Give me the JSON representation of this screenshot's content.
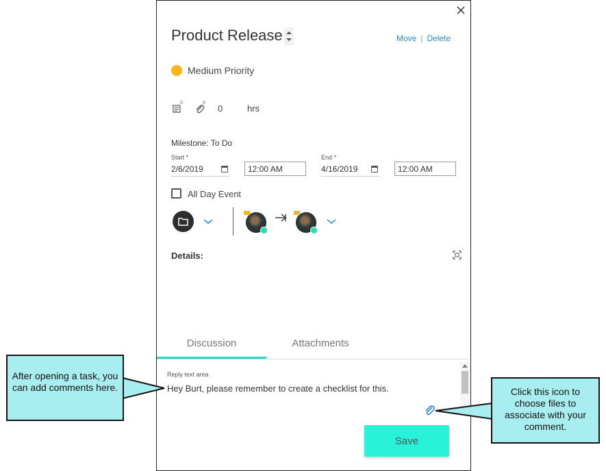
{
  "task": {
    "title": "Product Release",
    "links": {
      "move": "Move",
      "separator": "|",
      "delete": "Delete"
    },
    "priority": {
      "label": "Medium Priority",
      "color": "#fbb41c"
    },
    "stats": {
      "notes_count": "0",
      "attachments_count": "0",
      "hours_value": "0",
      "hours_unit": "hrs"
    },
    "milestone": "Milestone: To Do",
    "start": {
      "label": "Start *",
      "date": "2/6/2019",
      "time": "12:00 AM"
    },
    "end": {
      "label": "End *",
      "date": "4/16/2019",
      "time": "12:00 AM"
    },
    "all_day": {
      "label": "All Day Event",
      "checked": false
    },
    "details_label": "Details:"
  },
  "tabs": [
    {
      "label": "Discussion",
      "active": true
    },
    {
      "label": "Attachments",
      "active": false
    }
  ],
  "reply": {
    "label": "Reply text area",
    "text": "Hey Burt, please remember to create a checklist for this."
  },
  "save_label": "Save",
  "callouts": {
    "left": "After opening a task, you can add comments here.",
    "right": "Click this icon to choose files to associate with your comment."
  },
  "icons": {
    "close": "close-icon",
    "notes": "notes-icon",
    "attachment": "paperclip-icon",
    "calendar": "calendar-icon",
    "folder": "folder-icon",
    "chevron": "chevron-down-icon",
    "arrow": "arrow-right-icon",
    "expand": "expand-icon"
  },
  "colors": {
    "accent": "#28f2d8",
    "link": "#2a8ad4",
    "callout": "#a8eef0",
    "status": "#20e0b0"
  }
}
